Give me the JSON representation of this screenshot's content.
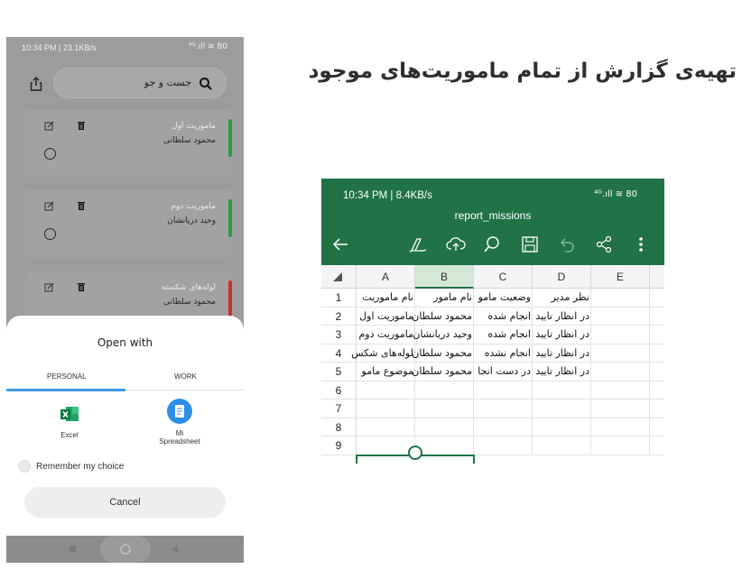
{
  "headline": "تهیه‌ی گزارش از تمام ماموریت‌های موجود",
  "phone": {
    "status_time": "10:34 PM | 23.1KB/s",
    "status_right": "⁴ᴳ.ıll ≋ 80",
    "search_placeholder": "جست و جو",
    "cards": [
      {
        "title": "ماموریت اول",
        "person": "محمود سلطانی",
        "status_color": "#2e9a3e"
      },
      {
        "title": "ماموریت دوم",
        "person": "وحید دریانشان",
        "status_color": "#2e9a3e"
      },
      {
        "title": "لوله‌های شکسته",
        "person": "محمود سلطانی",
        "status_color": "#c9302c"
      }
    ],
    "sheet": {
      "title": "Open with",
      "tab_personal": "PERSONAL",
      "tab_work": "WORK",
      "app1": "Excel",
      "app2_line1": "Mi",
      "app2_line2": "Spreadsheet",
      "remember": "Remember my choice",
      "cancel": "Cancel"
    }
  },
  "excel": {
    "status_time": "10:34 PM | 8.4KB/s",
    "status_right": "⁴ᴳ.ıll ≋ 80",
    "file_name": "report_missions",
    "columns": [
      "A",
      "B",
      "C",
      "D",
      "E"
    ],
    "row_numbers": [
      "1",
      "2",
      "3",
      "4",
      "5",
      "6",
      "7",
      "8",
      "9"
    ],
    "rows": [
      [
        "نام ماموریت",
        "نام مامور",
        "وضعیت مامو",
        "نظر مدیر",
        ""
      ],
      [
        "ماموریت اول",
        "محمود سلطان",
        "انجام شده",
        "در انظار تایید",
        ""
      ],
      [
        "ماموریت دوم",
        "وحید دریانشان",
        "انجام شده",
        "در انظار تایید",
        ""
      ],
      [
        "لوله‌های شکس",
        "محمود سلطان",
        "انجام نشده",
        "در انظار تایید",
        ""
      ],
      [
        "موضوع مامو",
        "محمود سلطان",
        "در دست انجا",
        "در انظار تایید",
        ""
      ]
    ],
    "header_color": "#217346"
  }
}
